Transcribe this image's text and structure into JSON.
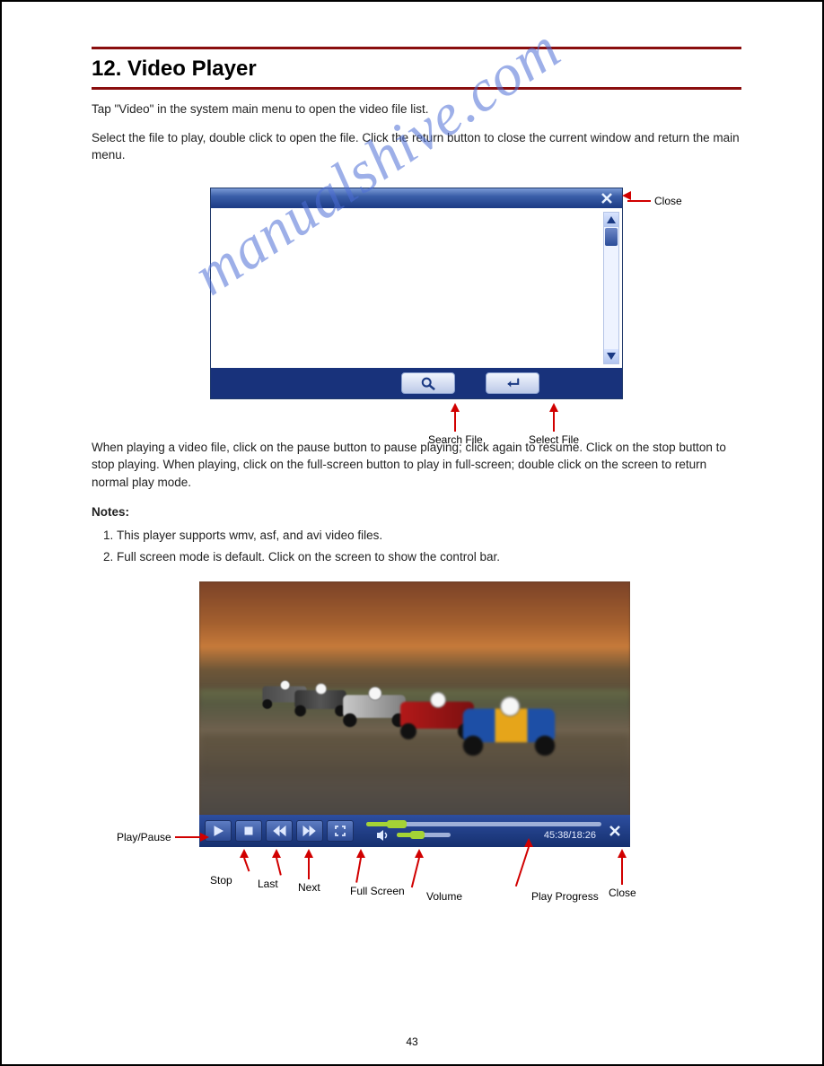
{
  "section": {
    "title": "12.  Video Player"
  },
  "intro": {
    "p1": "Tap \"Video\" in the system main menu to open the video file list.",
    "p2": "Select the file to play, double click to open the file. Click the return button to close the current window and return the main menu."
  },
  "fileBrowser": {
    "close_label": "Close",
    "callouts": {
      "close": "Close",
      "search": "Search File",
      "select": "Select File"
    }
  },
  "second": {
    "p1": "When playing a video file, click on the pause button to pause playing; click again to resume. Click on the stop button to stop playing. When playing, click on the full-screen button to play in full-screen; double click on the screen to return normal play mode.",
    "notes_title": "Notes:",
    "notes": [
      "This player supports wmv, asf, and avi video files.",
      "Full screen mode is default. Click on the screen to show the control bar."
    ]
  },
  "player": {
    "time": "45:38/18:26",
    "progress_fill_pct": 12,
    "volume_fill_pct": 35,
    "labels": {
      "play": "Play/Pause",
      "stop": "Stop",
      "prev": "Last",
      "next": "Next",
      "fullscreen": "Full Screen",
      "volume": "Volume",
      "progress": "Play Progress",
      "close": "Close"
    }
  },
  "footer": {
    "page": "43"
  },
  "watermark": "manualshive.com"
}
